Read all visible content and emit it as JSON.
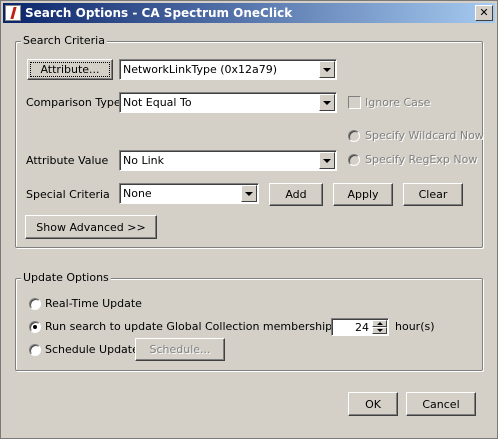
{
  "window": {
    "title": "Search Options - CA Spectrum OneClick",
    "close_glyph": "✕"
  },
  "search_criteria": {
    "legend": "Search Criteria",
    "attribute_button": "Attribute...",
    "attribute_value_selected": "NetworkLinkType (0x12a79)",
    "comparison_type_label": "Comparison Type",
    "comparison_type_selected": "Not Equal To",
    "ignore_case_label": "Ignore Case",
    "ignore_case_checked": false,
    "specify_wildcard_label": "Specify Wildcard Now",
    "specify_regexp_label": "Specify RegExp Now",
    "attribute_value_label": "Attribute Value",
    "attribute_value_field": "No Link",
    "special_criteria_label": "Special Criteria",
    "special_criteria_selected": "None",
    "add_button": "Add",
    "apply_button": "Apply",
    "clear_button": "Clear",
    "show_advanced_button": "Show Advanced >>"
  },
  "update_options": {
    "legend": "Update Options",
    "realtime_label": "Real-Time Update",
    "run_search_label": "Run search to update Global Collection membership every",
    "run_search_selected": true,
    "hours_value": "24",
    "hours_unit": "hour(s)",
    "schedule_label": "Schedule Update",
    "schedule_button": "Schedule..."
  },
  "footer": {
    "ok_button": "OK",
    "cancel_button": "Cancel"
  }
}
